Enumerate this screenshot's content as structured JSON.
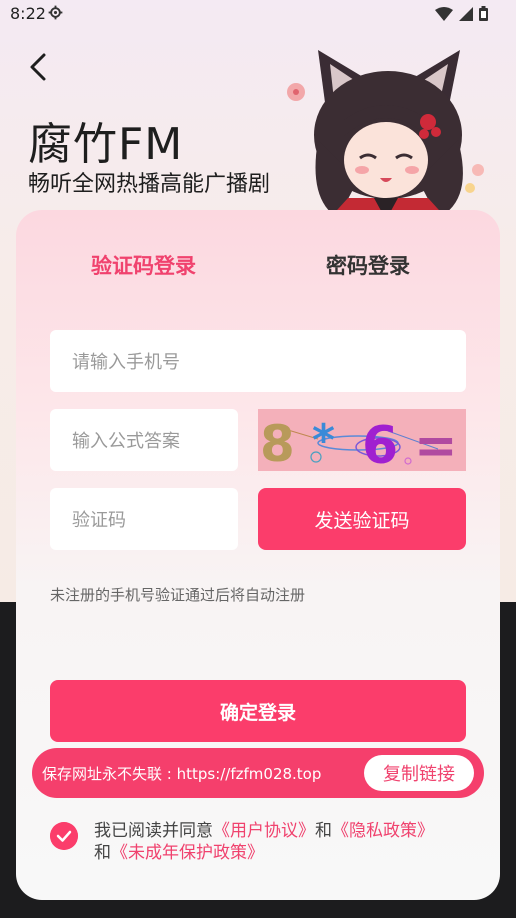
{
  "status": {
    "time": "8:22",
    "icons": [
      "gear-icon",
      "wifi-icon",
      "signal-icon",
      "battery-icon"
    ]
  },
  "header": {
    "back_icon": "chevron-left-icon",
    "title": "腐竹FM",
    "subtitle": "畅听全网热播高能广播剧"
  },
  "tabs": [
    {
      "label": "验证码登录",
      "active": true
    },
    {
      "label": "密码登录",
      "active": false
    }
  ],
  "form": {
    "phone_placeholder": "请输入手机号",
    "formula_placeholder": "输入公式答案",
    "captcha_text": "8 * 6 =",
    "code_placeholder": "验证码",
    "send_code_label": "发送验证码",
    "hint": "未注册的手机号验证通过后将自动注册",
    "login_label": "确定登录"
  },
  "banner": {
    "text": "保存网址永不失联 : https://fzfm028.top",
    "copy_label": "复制链接"
  },
  "agreement": {
    "prefix": "我已阅读并同意",
    "user_agreement": "《用户协议》",
    "and1": "和",
    "privacy": "《隐私政策》",
    "and2": "和",
    "minor_policy": "《未成年保护政策》",
    "checked": true
  },
  "colors": {
    "accent": "#fb3d6b",
    "tab_active": "#f0426e"
  }
}
